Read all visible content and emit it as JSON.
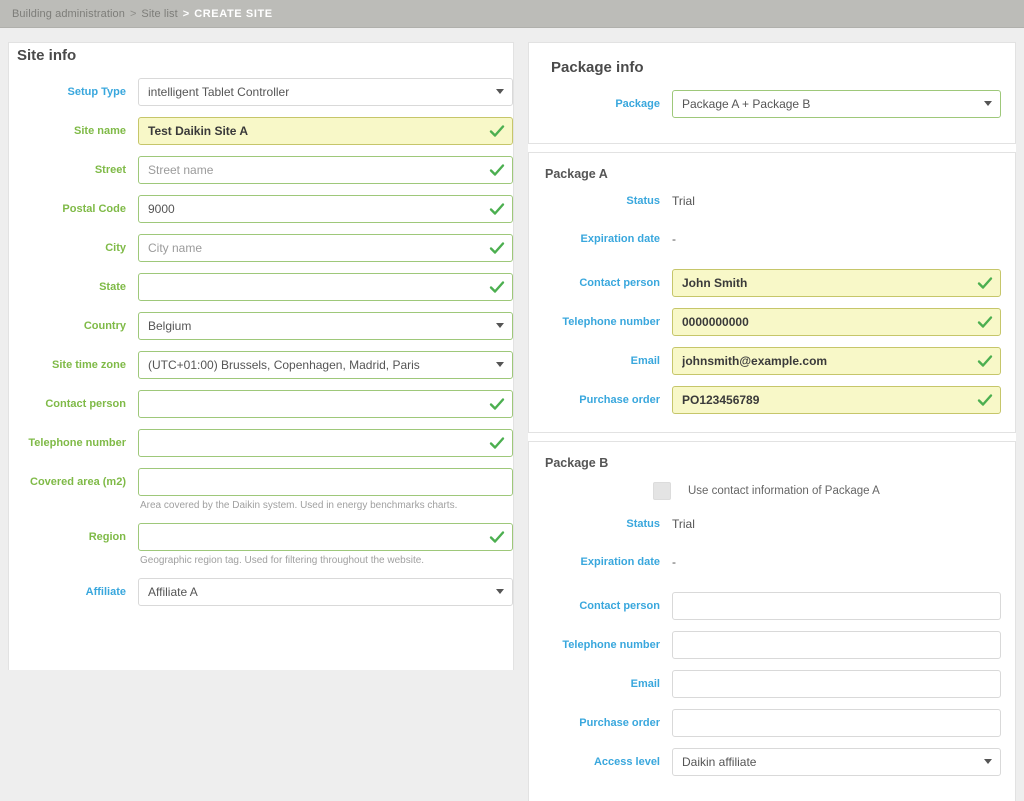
{
  "breadcrumb": {
    "items": [
      "Building administration",
      "Site list"
    ],
    "separator": ">",
    "current": "CREATE SITE"
  },
  "colors": {
    "label_green": "#7fba47",
    "label_blue": "#39a7dd",
    "input_border_green": "#9ec87a",
    "autofill_bg": "#f8f8c8",
    "check_green": "#4caf50",
    "topbar_bg": "#bcbcb8"
  },
  "site_info": {
    "title": "Site info",
    "fields": {
      "setup_type": {
        "label": "Setup Type",
        "value": "intelligent Tablet Controller"
      },
      "site_name": {
        "label": "Site name",
        "value": "Test Daikin Site A"
      },
      "street": {
        "label": "Street",
        "placeholder": "Street name",
        "value": ""
      },
      "postal_code": {
        "label": "Postal Code",
        "value": "9000"
      },
      "city": {
        "label": "City",
        "placeholder": "City name",
        "value": ""
      },
      "state": {
        "label": "State",
        "value": ""
      },
      "country": {
        "label": "Country",
        "value": "Belgium"
      },
      "site_time_zone": {
        "label": "Site time zone",
        "value": "(UTC+01:00) Brussels, Copenhagen, Madrid, Paris"
      },
      "contact_person": {
        "label": "Contact person",
        "value": ""
      },
      "telephone_number": {
        "label": "Telephone number",
        "value": ""
      },
      "covered_area": {
        "label": "Covered area (m2)",
        "value": "",
        "helper": "Area covered by the Daikin system. Used in energy benchmarks charts."
      },
      "region": {
        "label": "Region",
        "value": "",
        "helper": "Geographic region tag. Used for filtering throughout the website."
      },
      "affiliate": {
        "label": "Affiliate",
        "value": "Affiliate A"
      }
    }
  },
  "package_info": {
    "title": "Package info",
    "package": {
      "label": "Package",
      "value": "Package A + Package B"
    },
    "package_a": {
      "title": "Package A",
      "status": {
        "label": "Status",
        "value": "Trial"
      },
      "expiration_date": {
        "label": "Expiration date",
        "value": "-"
      },
      "contact_person": {
        "label": "Contact person",
        "value": "John Smith"
      },
      "telephone_number": {
        "label": "Telephone number",
        "value": "0000000000"
      },
      "email": {
        "label": "Email",
        "value": "johnsmith@example.com"
      },
      "purchase_order": {
        "label": "Purchase order",
        "value": "PO123456789"
      }
    },
    "package_b": {
      "title": "Package B",
      "use_contact_checkbox": {
        "label": "Use contact information of Package A",
        "checked": false
      },
      "status": {
        "label": "Status",
        "value": "Trial"
      },
      "expiration_date": {
        "label": "Expiration date",
        "value": "-"
      },
      "contact_person": {
        "label": "Contact person",
        "value": ""
      },
      "telephone_number": {
        "label": "Telephone number",
        "value": ""
      },
      "email": {
        "label": "Email",
        "value": ""
      },
      "purchase_order": {
        "label": "Purchase order",
        "value": ""
      },
      "access_level": {
        "label": "Access level",
        "value": "Daikin affiliate"
      }
    }
  }
}
